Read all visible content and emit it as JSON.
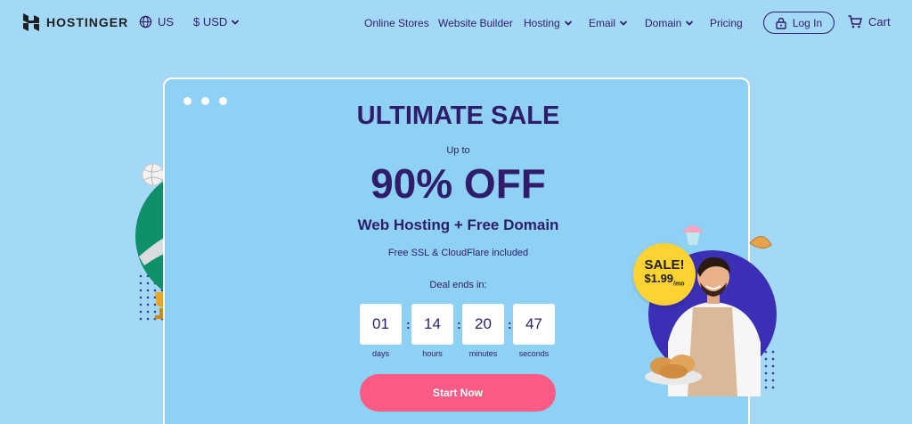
{
  "nav": {
    "brand": "HOSTINGER",
    "locale": "US",
    "currency": "$ USD",
    "links": [
      {
        "label": "Online Stores",
        "dropdown": false
      },
      {
        "label": "Website Builder",
        "dropdown": false
      },
      {
        "label": "Hosting",
        "dropdown": true
      },
      {
        "label": "Email",
        "dropdown": true
      },
      {
        "label": "Domain",
        "dropdown": true
      },
      {
        "label": "Pricing",
        "dropdown": false
      }
    ],
    "login": "Log In",
    "cart": "Cart"
  },
  "hero": {
    "title": "ULTIMATE SALE",
    "upto": "Up to",
    "discount": "90% OFF",
    "subtitle": "Web Hosting + Free Domain",
    "note": "Free SSL & CloudFlare included",
    "deal_label": "Deal ends in:",
    "timer": [
      {
        "value": "01",
        "unit": "days"
      },
      {
        "value": "14",
        "unit": "hours"
      },
      {
        "value": "20",
        "unit": "minutes"
      },
      {
        "value": "47",
        "unit": "seconds"
      }
    ],
    "cta": "Start Now"
  },
  "badge": {
    "line1": "SALE!",
    "price": "$1.99",
    "price_suffix": "/mo"
  },
  "icons": [
    "globe-icon",
    "chevron-down-icon",
    "lock-icon",
    "cart-icon"
  ],
  "colors": {
    "background": "#a3d9f6",
    "text": "#2f1c6a",
    "cta": "#fb5b84",
    "badge": "#ffd233"
  }
}
